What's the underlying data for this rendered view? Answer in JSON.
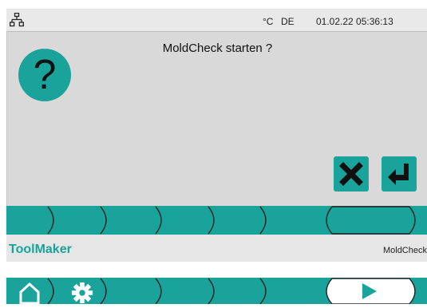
{
  "status": {
    "unit": "°C",
    "language": "DE",
    "datetime": "01.02.22 05:36:13"
  },
  "dialog": {
    "title": "MoldCheck starten ?",
    "question_symbol": "?"
  },
  "footer": {
    "brand": "ToolMaker",
    "module": "MoldCheck"
  },
  "icons": {
    "network": "network-icon",
    "question": "question-icon",
    "cancel": "x-icon",
    "confirm": "enter-icon",
    "home": "home-icon",
    "settings": "gear-icon",
    "play": "play-icon"
  },
  "colors": {
    "accent": "#1aa39b",
    "panel": "#d9d9d9",
    "statusbar": "#e9e9e9"
  }
}
